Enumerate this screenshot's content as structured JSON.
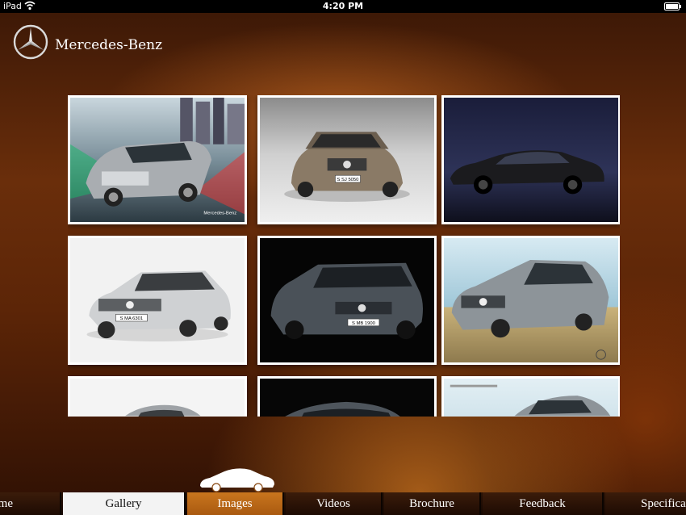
{
  "status_bar": {
    "carrier": "iPad",
    "time": "4:20 PM"
  },
  "brand": {
    "name": "Mercedes-Benz"
  },
  "gallery": {
    "thumbnails": [
      {
        "scene": "city-street-wagon",
        "caption": "Mercedes-Benz"
      },
      {
        "scene": "studio-sedan-front",
        "plate": "S SJ 5050"
      },
      {
        "scene": "dark-sedan-side"
      },
      {
        "scene": "white-sedan",
        "plate": "S MA 6301"
      },
      {
        "scene": "black-wagon",
        "plate": "S MB 1900"
      },
      {
        "scene": "coupe-brochure"
      },
      {
        "scene": "white-partial"
      },
      {
        "scene": "black-partial"
      },
      {
        "scene": "brochure-partial"
      }
    ]
  },
  "tabs": [
    {
      "label": "me"
    },
    {
      "label": "Gallery"
    },
    {
      "label": "Images"
    },
    {
      "label": "Videos"
    },
    {
      "label": "Brochure"
    },
    {
      "label": "Feedback"
    },
    {
      "label": "Specificat"
    }
  ],
  "colors": {
    "active_tab": "#b8661a",
    "background": "#5c2507"
  }
}
